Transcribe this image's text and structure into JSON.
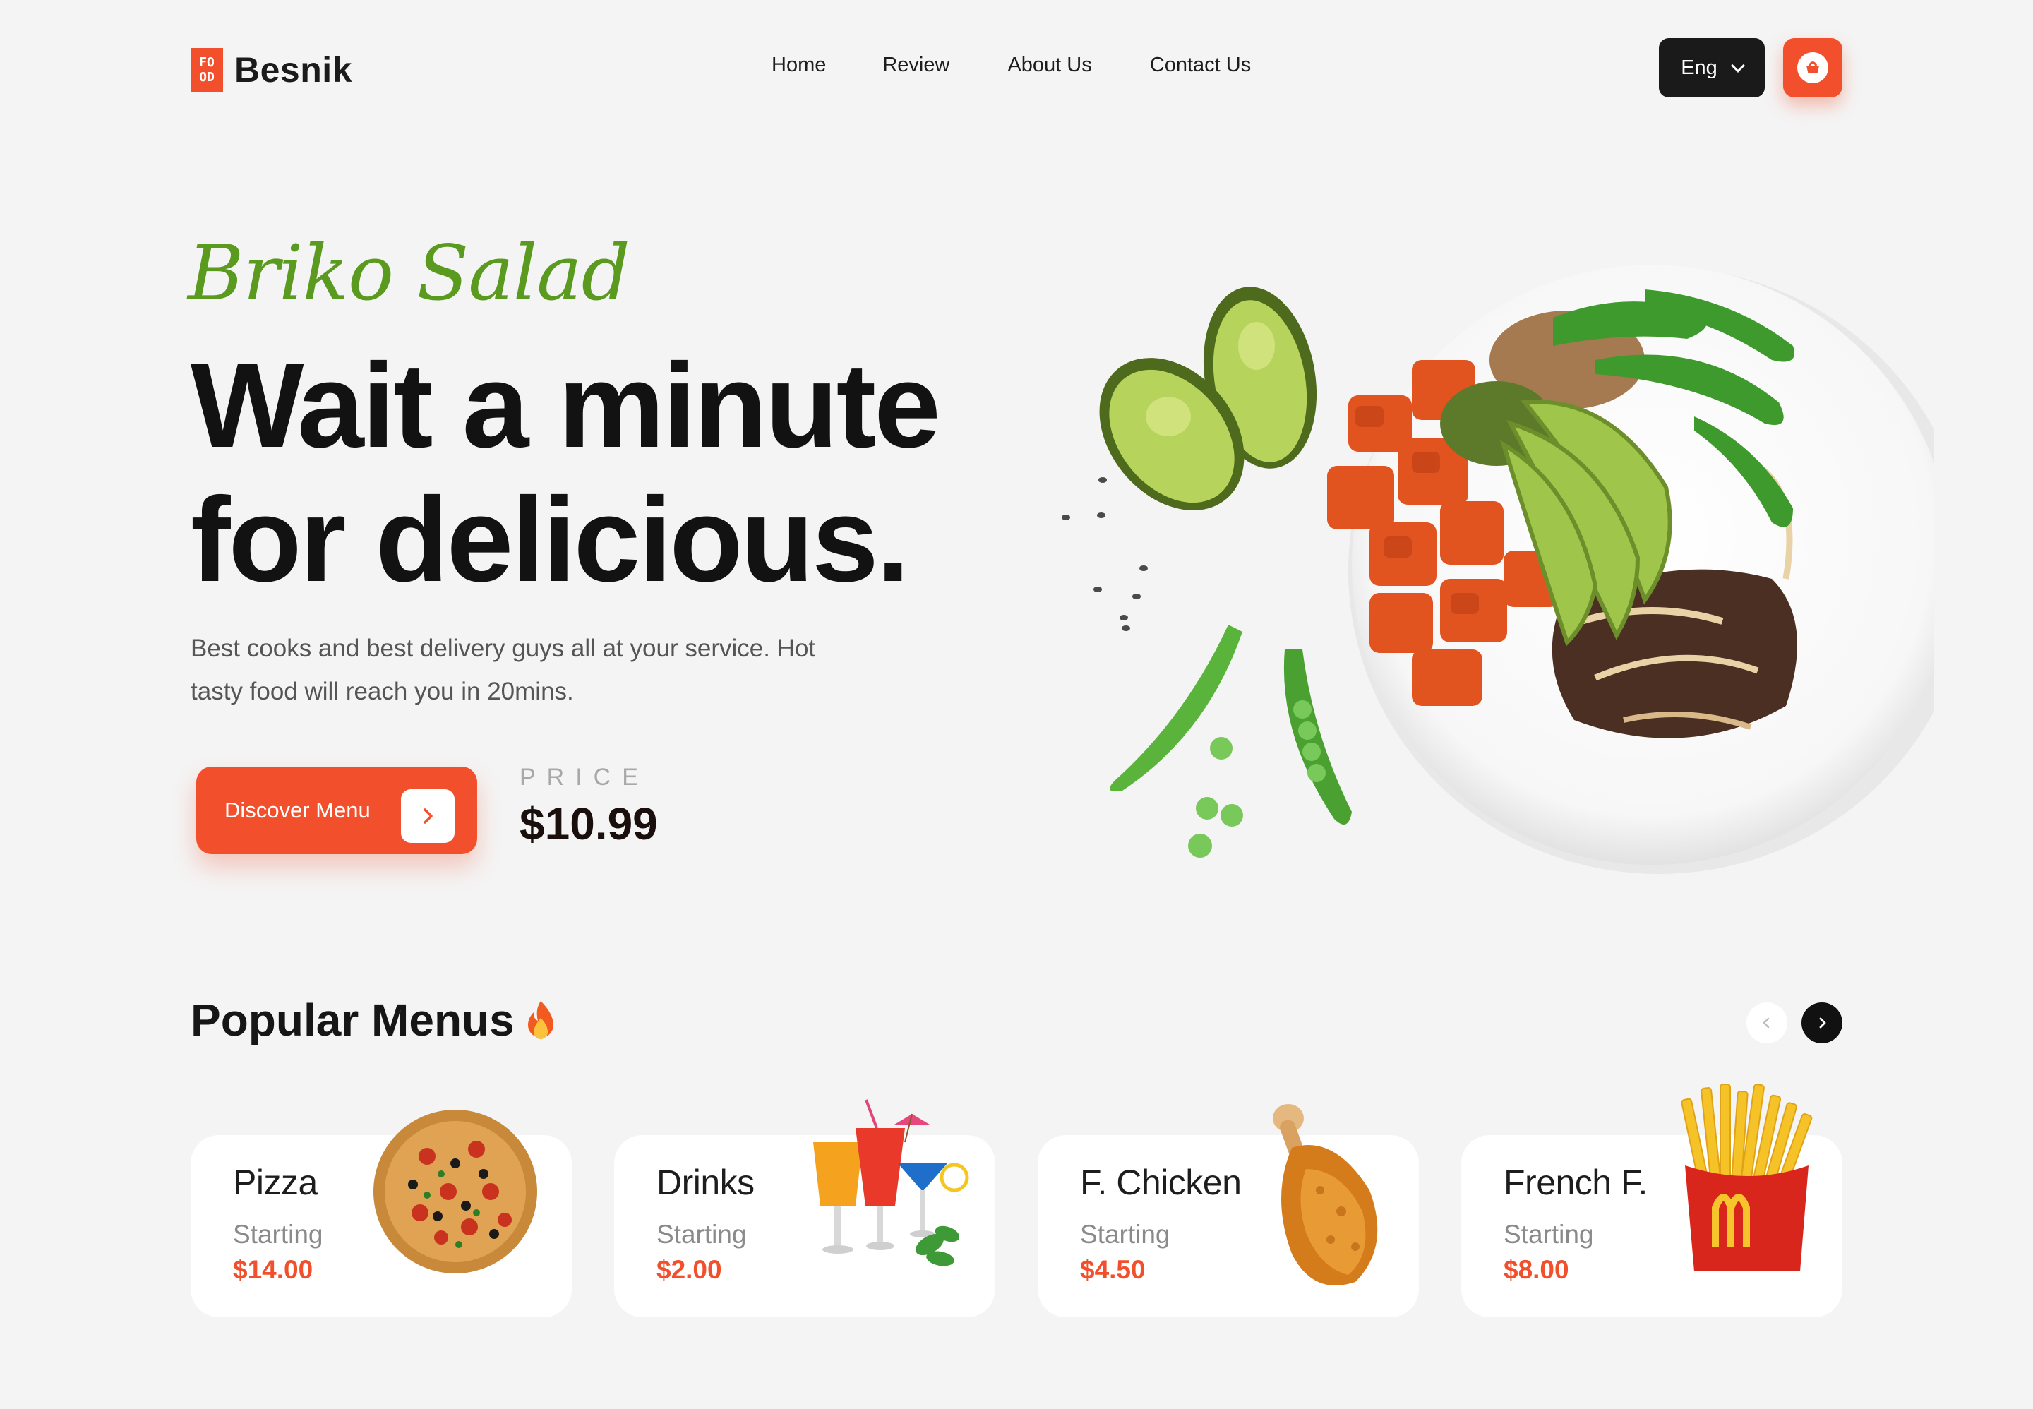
{
  "brand": {
    "logo_mark": [
      "FO",
      "OD"
    ],
    "name": "Besnik",
    "accent": "#f2502c"
  },
  "nav": {
    "items": [
      "Home",
      "Review",
      "About Us",
      "Contact Us"
    ]
  },
  "header": {
    "language": "Eng",
    "cart_icon": "basket-icon"
  },
  "hero": {
    "script_title": "Briko Salad",
    "headline_line1": "Wait a minute",
    "headline_line2": "for delicious.",
    "subtitle": "Best cooks and best delivery guys all at your service. Hot tasty food will reach you in 20mins.",
    "cta_label": "Discover Menu",
    "price_label": "PRICE",
    "price": "$10.99"
  },
  "popular": {
    "title": "Popular Menus",
    "title_icon": "fire-icon",
    "cards": [
      {
        "name": "Pizza",
        "starting": "Starting",
        "price": "$14.00"
      },
      {
        "name": "Drinks",
        "starting": "Starting",
        "price": "$2.00"
      },
      {
        "name": "F. Chicken",
        "starting": "Starting",
        "price": "$4.50"
      },
      {
        "name": "French F.",
        "starting": "Starting",
        "price": "$8.00"
      }
    ]
  }
}
